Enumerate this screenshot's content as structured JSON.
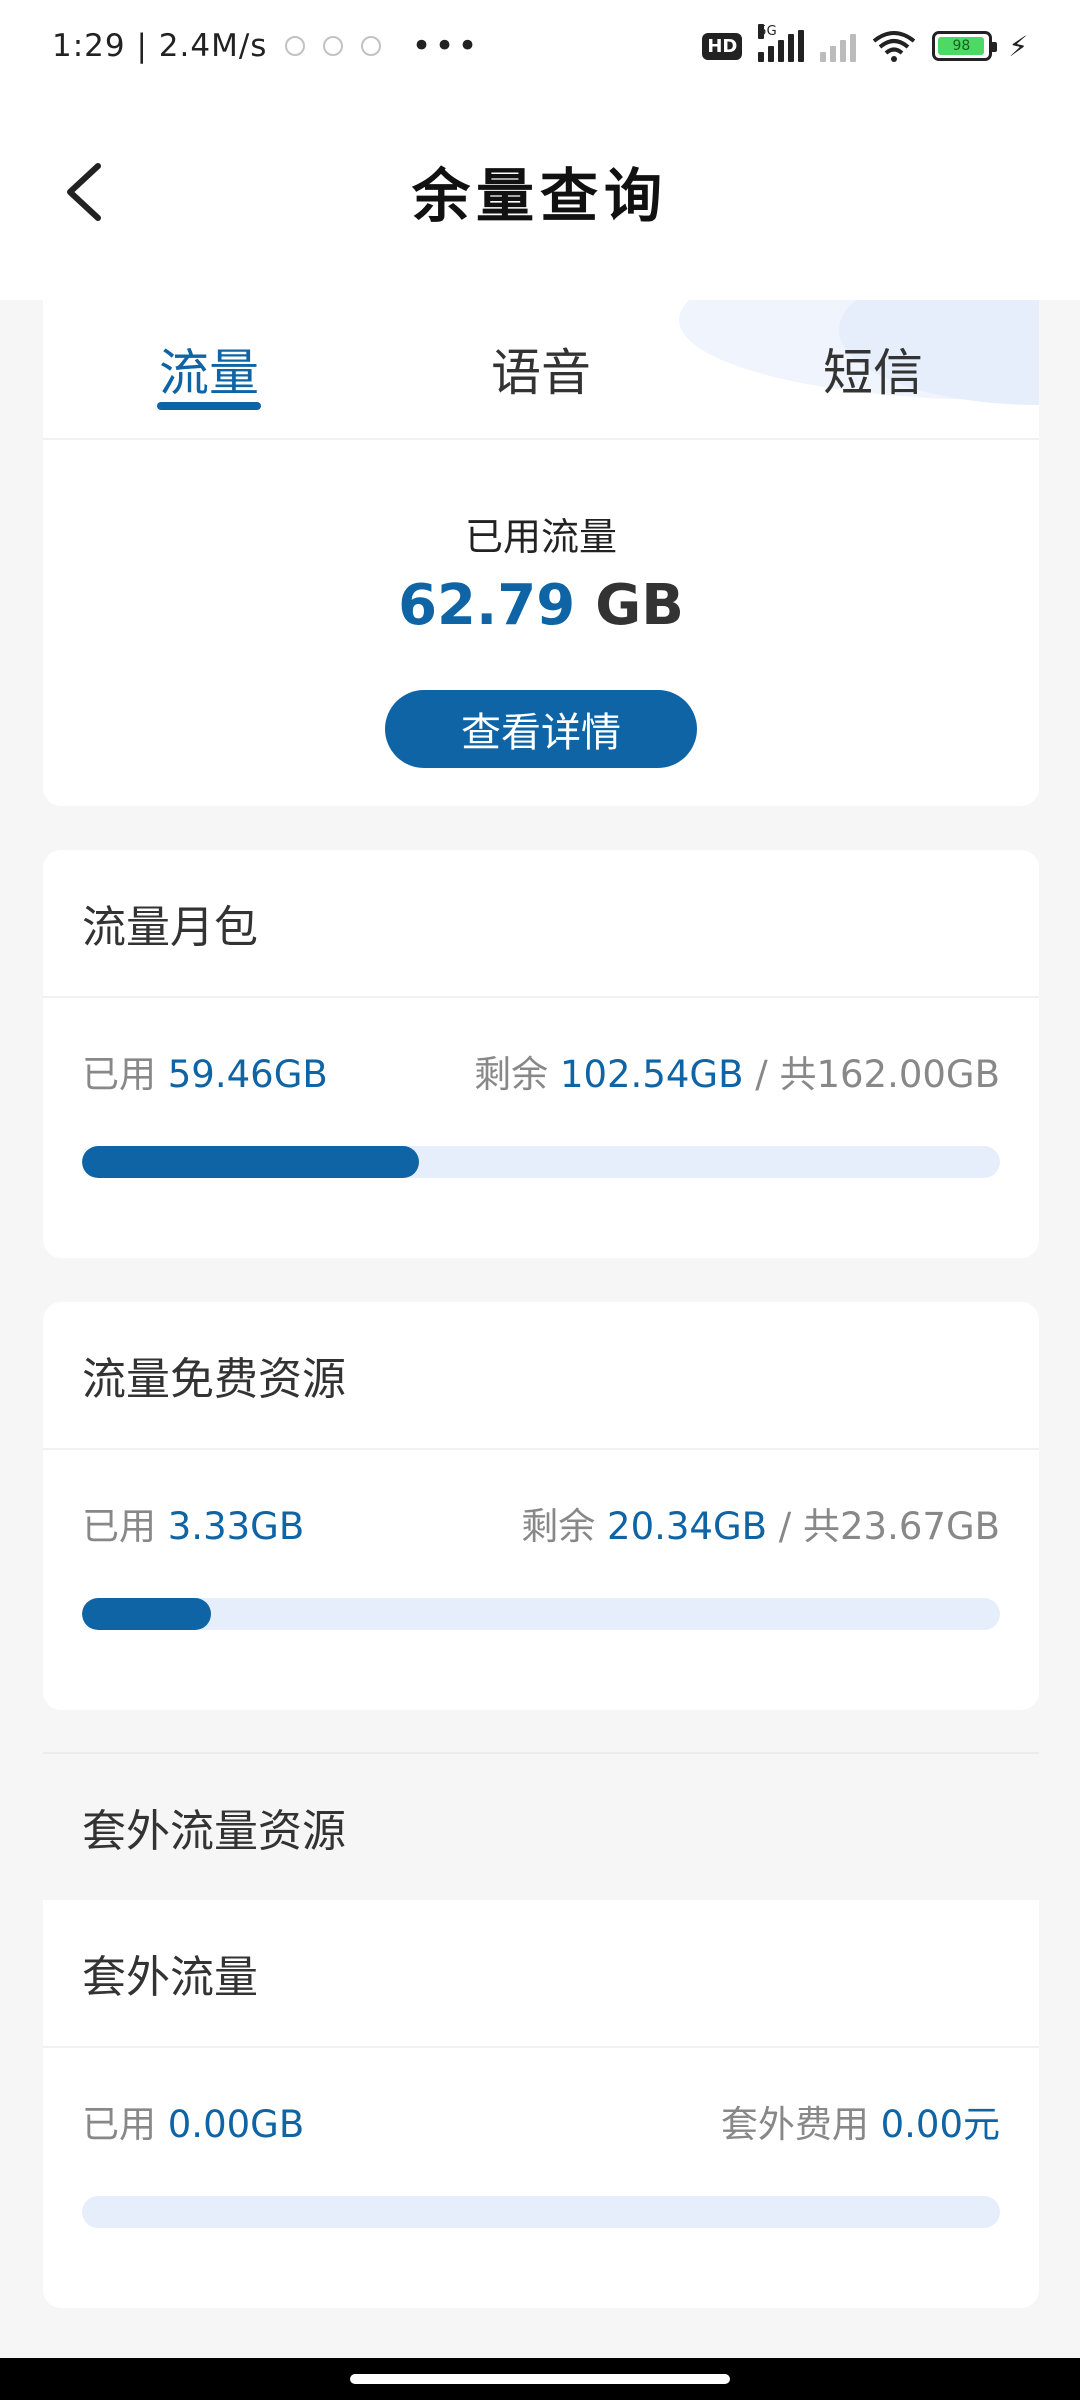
{
  "status_bar": {
    "time": "1:29",
    "speed": "2.4M/s",
    "hd": "HD",
    "network": "5G",
    "battery": "98"
  },
  "header": {
    "title": "余量查询"
  },
  "tabs": [
    {
      "label": "流量",
      "active": true
    },
    {
      "label": "语音",
      "active": false
    },
    {
      "label": "短信",
      "active": false
    }
  ],
  "summary": {
    "used_label": "已用流量",
    "used_value": "62.79",
    "used_unit": "GB",
    "detail_button": "查看详情"
  },
  "packages": [
    {
      "title": "流量月包",
      "used_label": "已用",
      "used": "59.46GB",
      "remain_label": "剩余",
      "remain": "102.54GB",
      "separator": "/",
      "total": "共162.00GB",
      "progress": 0.367
    },
    {
      "title": "流量免费资源",
      "used_label": "已用",
      "used": "3.33GB",
      "remain_label": "剩余",
      "remain": "20.34GB",
      "separator": "/",
      "total": "共23.67GB",
      "progress": 0.141
    }
  ],
  "extra": {
    "section_title": "套外流量资源",
    "title": "套外流量",
    "used_label": "已用",
    "used": "0.00GB",
    "fee_label": "套外费用",
    "fee": "0.00元",
    "progress": 0
  },
  "colors": {
    "accent": "#0e64a4",
    "track": "#e7eefb",
    "background": "#f6f6f7"
  }
}
